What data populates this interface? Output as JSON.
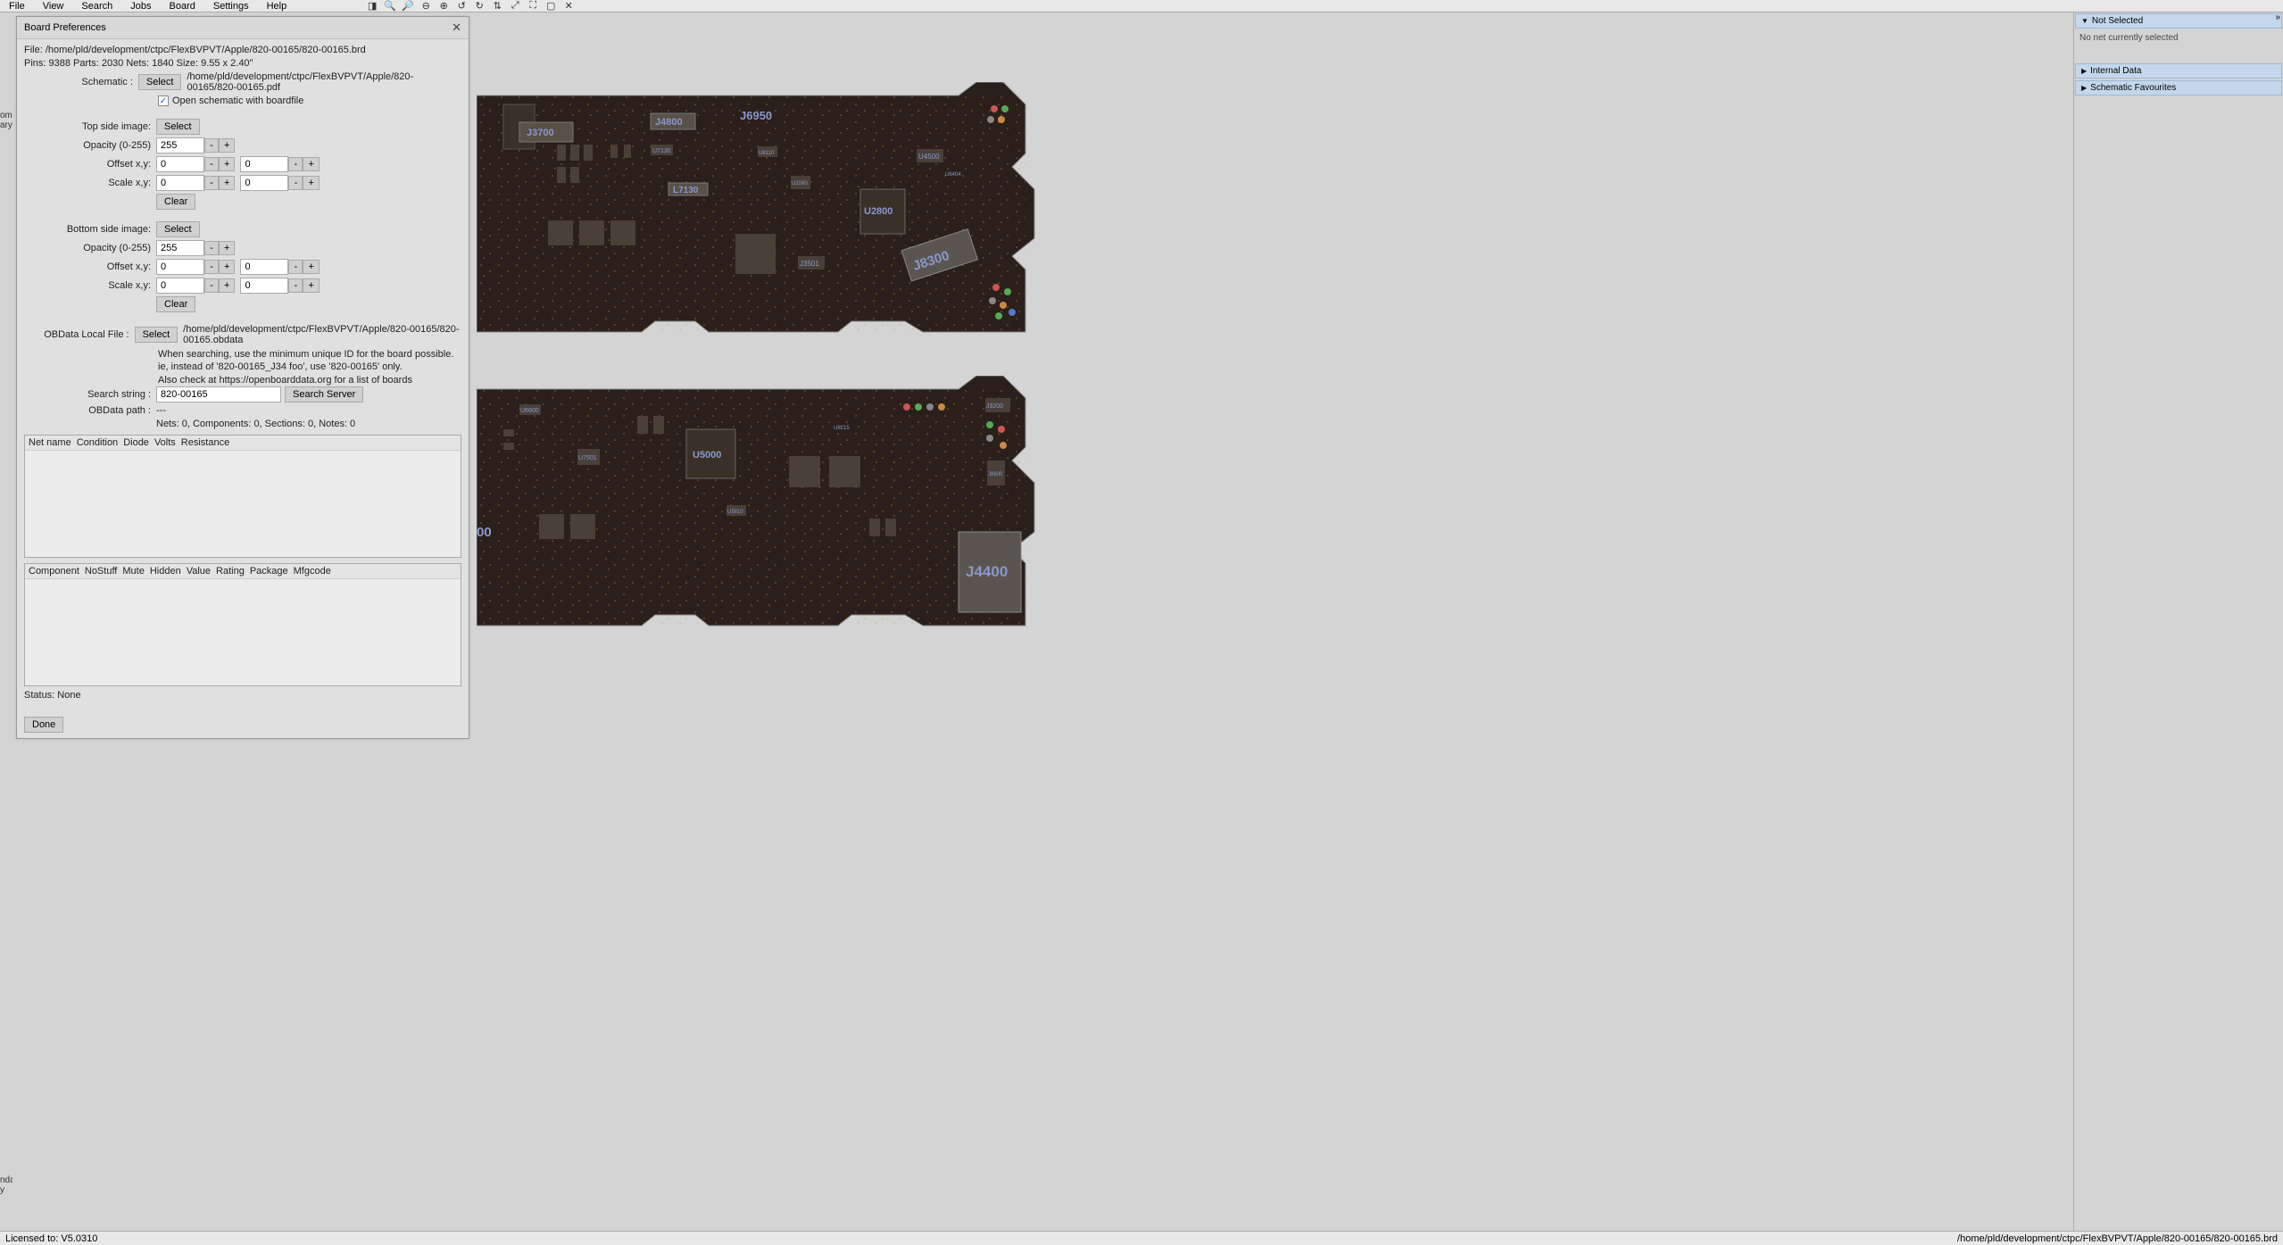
{
  "menubar": {
    "items": [
      "File",
      "View",
      "Search",
      "Jobs",
      "Board",
      "Settings",
      "Help"
    ]
  },
  "left_strip": {
    "top1": "om",
    "top2": "ary",
    "bot1": "nda",
    "bot2": "y"
  },
  "dialog": {
    "title": "Board Preferences",
    "file_line": "File: /home/pld/development/ctpc/FlexBVPVT/Apple/820-00165/820-00165.brd",
    "stats_line": "Pins: 9388  Parts: 2030  Nets: 1840  Size: 9.55 x 2.40\"",
    "schematic_label": "Schematic :",
    "select_btn": "Select",
    "schematic_path": "/home/pld/development/ctpc/FlexBVPVT/Apple/820-00165/820-00165.pdf",
    "open_schematic_chk": "Open schematic with boardfile",
    "top_side_image_label": "Top side image:",
    "opacity_label": "Opacity (0-255)",
    "offset_label": "Offset x,y:",
    "scale_label": "Scale x,y:",
    "clear_btn": "Clear",
    "bottom_side_image_label": "Bottom side image:",
    "obdata_label": "OBData Local File :",
    "obdata_path": "/home/pld/development/ctpc/FlexBVPVT/Apple/820-00165/820-00165.obdata",
    "note1": "When searching, use the minimum unique ID for the board possible.",
    "note2": "ie, instead of '820-00165_J34 foo', use '820-00165' only.",
    "note3": "Also check at https://openboarddata.org for a list of boards",
    "search_string_label": "Search string :",
    "search_string_value": "820-00165",
    "search_server_btn": "Search Server",
    "obdata_path_label": "OBData path :",
    "obdata_path_value": "---",
    "counts_line": "Nets: 0, Components: 0, Sections: 0, Notes: 0",
    "table1_headers": [
      "Net name",
      "Condition",
      "Diode",
      "Volts",
      "Resistance"
    ],
    "table2_headers": [
      "Component",
      "NoStuff",
      "Mute",
      "Hidden",
      "Value",
      "Rating",
      "Package",
      "Mfgcode"
    ],
    "status_line": "Status: None",
    "done_btn": "Done",
    "top": {
      "opacity": "255",
      "ox": "0",
      "oy": "0",
      "sx": "0",
      "sy": "0"
    },
    "bot": {
      "opacity": "255",
      "ox": "0",
      "oy": "0",
      "sx": "0",
      "sy": "0"
    },
    "minus": "-",
    "plus": "+"
  },
  "right": {
    "not_selected": "Not Selected",
    "no_net": "No net currently selected",
    "internal_data": "Internal Data",
    "schematic_fav": "Schematic Favourites"
  },
  "status": {
    "licensed": "Licensed to:   V5.0310",
    "path": "/home/pld/development/ctpc/FlexBVPVT/Apple/820-00165/820-00165.brd"
  },
  "board_labels_top": {
    "J3700": "J3700",
    "J4800": "J4800",
    "J6950": "J6950",
    "U7130b": "U7130",
    "L7130": "L7130",
    "U2800": "U2800",
    "J3501": "J3501",
    "J8300": "J8300",
    "U4500": "U4500",
    "U2090": "U2090",
    "U8110": "U8110",
    "U6404": "U6404"
  },
  "board_labels_bot": {
    "U5000": "U5000",
    "U6600": "U6600",
    "J4400": "J4400",
    "U7501": "U7501",
    "U5810": "U5810",
    "J3200": "J3200",
    "J8600": "J8600",
    "U8215": "U8215",
    "partial00": "00"
  }
}
